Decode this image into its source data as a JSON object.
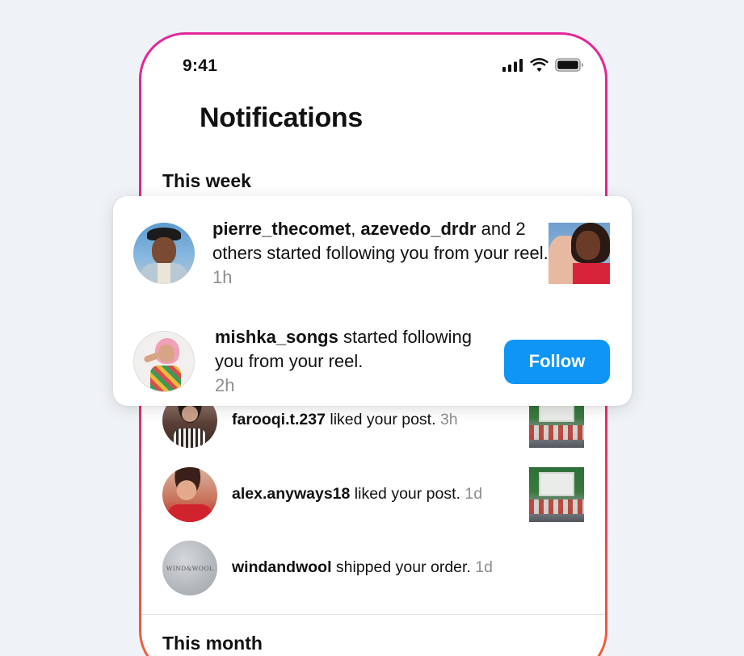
{
  "status_bar": {
    "time": "9:41"
  },
  "header": {
    "title": "Notifications"
  },
  "sections": {
    "this_week": "This week",
    "this_month": "This month"
  },
  "card": {
    "item1": {
      "user1": "pierre_thecomet",
      "separator": ", ",
      "user2": "azevedo_drdr",
      "text": " and 2 others started following you from your reel.",
      "time": "1h"
    },
    "item2": {
      "user": "mishka_songs",
      "text": " started following you from your reel.",
      "time": "2h",
      "button": "Follow"
    }
  },
  "notifications": [
    {
      "user": "farooqi.t.237",
      "text": " liked your post.",
      "time": "3h"
    },
    {
      "user": "alex.anyways18",
      "text": " liked your post.",
      "time": "1d"
    },
    {
      "user": "windandwool",
      "text": " shipped your order.",
      "time": "1d",
      "avatar_text": "WIND&WOOL"
    }
  ],
  "colors": {
    "accent": "#0f95f5",
    "frame_top": "#e1279a",
    "frame_bottom": "#f0653a",
    "muted": "#8e8e8e"
  }
}
